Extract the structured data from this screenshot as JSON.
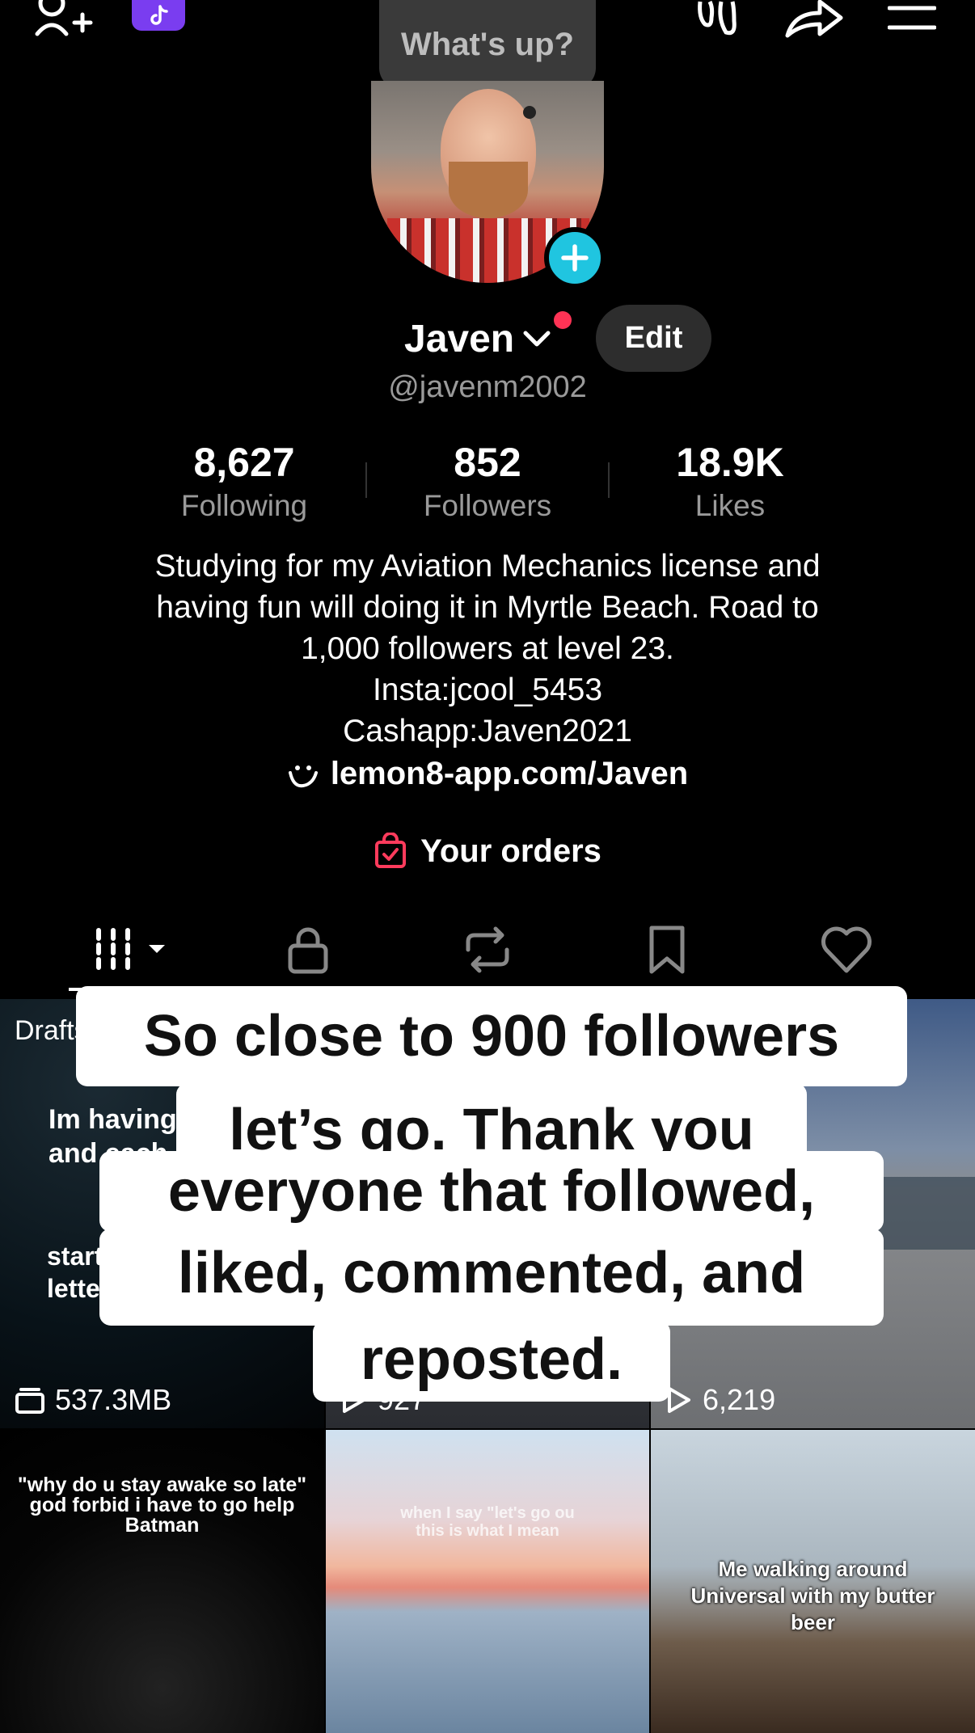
{
  "topbar": {
    "add_friend_icon": "person-plus-icon",
    "tiktok_icon": "tiktok-note-icon",
    "whats_up": "What's up?",
    "footprint_icon": "footprints-icon",
    "share_icon": "share-arrow-icon",
    "menu_icon": "hamburger-menu-icon"
  },
  "profile": {
    "display_name": "Javen",
    "handle": "@javenm2002",
    "edit_label": "Edit",
    "stats": [
      {
        "value": "8,627",
        "label": "Following"
      },
      {
        "value": "852",
        "label": "Followers"
      },
      {
        "value": "18.9K",
        "label": "Likes"
      }
    ],
    "bio_lines": [
      "Studying for my Aviation Mechanics license and",
      "having fun will doing it in Myrtle Beach. Road to",
      "1,000 followers at level 23.",
      "Insta:jcool_5453",
      "Cashapp:Javen2021"
    ],
    "link": "lemon8-app.com/Javen",
    "orders": "Your orders"
  },
  "tabs": [
    {
      "icon": "videos-grid-icon"
    },
    {
      "icon": "lock-icon"
    },
    {
      "icon": "repost-icon"
    },
    {
      "icon": "bookmark-icon"
    },
    {
      "icon": "heart-icon"
    }
  ],
  "grid": {
    "cell1": {
      "badge": "Drafts",
      "caption_lines": [
        "Im having",
        "and each",
        "start",
        "letter"
      ],
      "count": "537.3MB"
    },
    "cell2": {
      "count": "927"
    },
    "cell3": {
      "count": "6,219"
    },
    "cell4": {
      "caption_lines": [
        "\"why do u stay awake so late\"",
        "god forbid i have to go help",
        "Batman"
      ]
    },
    "cell5": {
      "caption_lines": [
        "when I say \"let's go ou",
        "this is what I mean"
      ]
    },
    "cell6": {
      "caption_lines": [
        "Me walking around",
        "Universal with my butter",
        "beer"
      ]
    }
  },
  "overlay_caption": [
    "So close to 900 followers",
    "let’s go. Thank you",
    "everyone that followed,",
    "liked, commented, and",
    "reposted."
  ],
  "colors": {
    "background": "#000000",
    "accent_cyan": "#20c5e0",
    "notification_red": "#ff3355",
    "orders_icon": "#ff3b5c",
    "tiktok_purple": "#7a3df0"
  }
}
